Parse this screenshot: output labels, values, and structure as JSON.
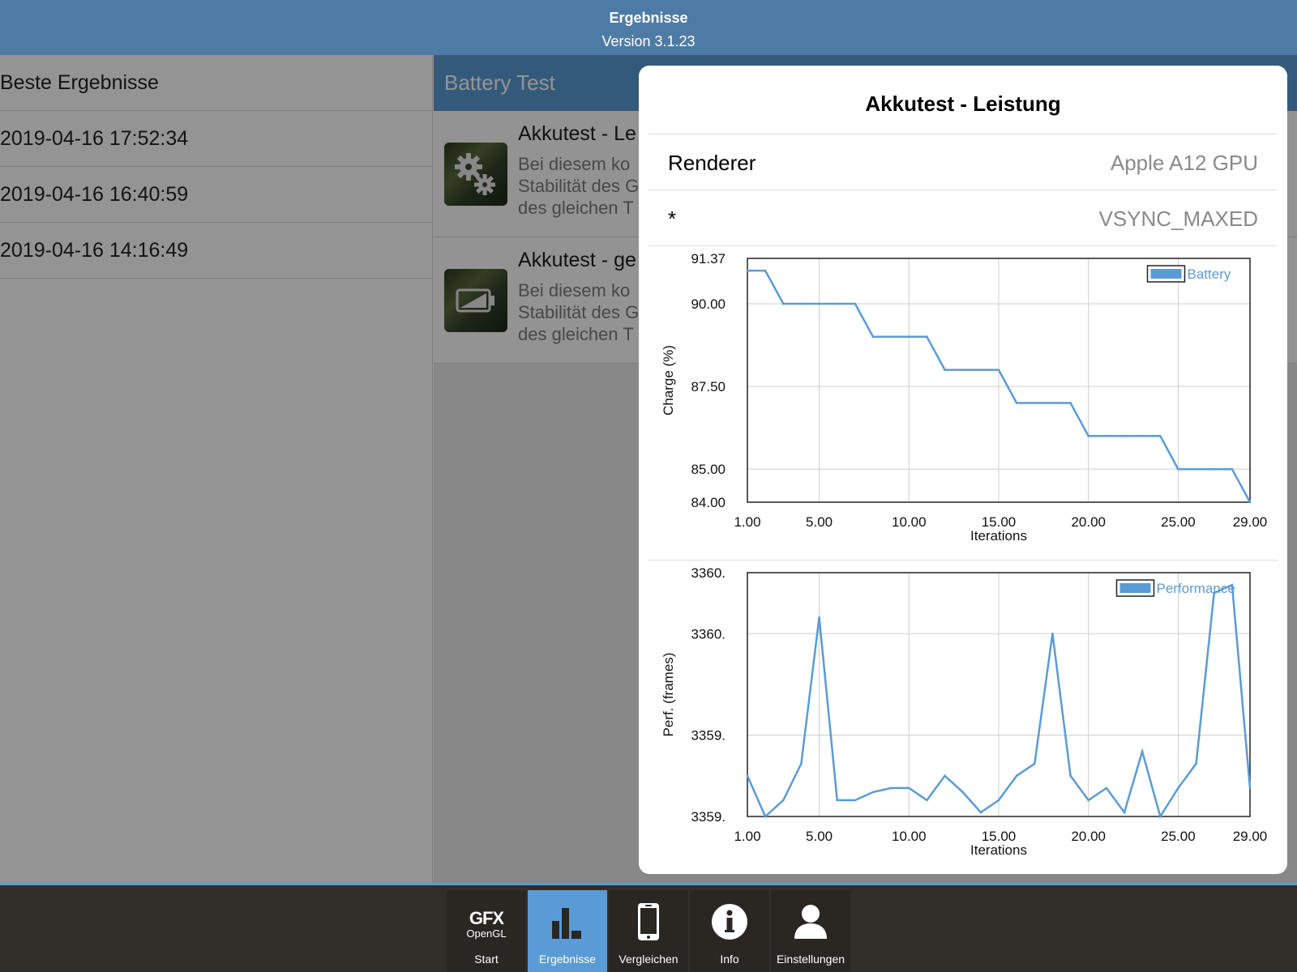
{
  "header": {
    "title": "Ergebnisse",
    "subtitle": "Version 3.1.23"
  },
  "left_list": {
    "title": "Beste Ergebnisse",
    "items": [
      "2019-04-16 17:52:34",
      "2019-04-16 16:40:59",
      "2019-04-16 14:16:49"
    ]
  },
  "middle": {
    "header": "Battery Test",
    "items": [
      {
        "title": "Akkutest - Le",
        "desc": [
          "Bei diesem ko",
          "Stabilität des G",
          "des gleichen T"
        ],
        "icon": "gears-icon"
      },
      {
        "title": "Akkutest - ge",
        "desc": [
          "Bei diesem ko",
          "Stabilität des G",
          "des gleichen T"
        ],
        "icon": "battery-icon"
      }
    ]
  },
  "popover": {
    "title": "Akkutest - Leistung",
    "rows": [
      {
        "key": "Renderer",
        "value": "Apple A12 GPU"
      },
      {
        "key": "*",
        "value": "VSYNC_MAXED"
      }
    ]
  },
  "colors": {
    "accent": "#5b9bd5",
    "header": "#4e7ba6",
    "line": "#5b9bd5",
    "tabbar": "#322e2a"
  },
  "chart_data": [
    {
      "type": "line",
      "ylabel": "Charge (%)",
      "xlabel": "Iterations",
      "xlim": [
        1,
        29
      ],
      "ylim": [
        84.0,
        91.37
      ],
      "xticks": [
        "1.00",
        "5.00",
        "10.00",
        "15.00",
        "20.00",
        "25.00",
        "29.00"
      ],
      "xtick_values": [
        1,
        5,
        10,
        15,
        20,
        25,
        29
      ],
      "yticks": [
        "91.37",
        "90.00",
        "87.50",
        "85.00",
        "84.00"
      ],
      "ytick_values": [
        91.37,
        90.0,
        87.5,
        85.0,
        84.0
      ],
      "grid": true,
      "legend_position": "top-right",
      "series": [
        {
          "name": "Battery",
          "x": [
            1,
            2,
            3,
            4,
            5,
            6,
            7,
            8,
            9,
            10,
            11,
            12,
            13,
            14,
            15,
            16,
            17,
            18,
            19,
            20,
            21,
            22,
            23,
            24,
            25,
            26,
            27,
            28,
            29
          ],
          "values": [
            91,
            91,
            90,
            90,
            90,
            90,
            90,
            89,
            89,
            89,
            89,
            88,
            88,
            88,
            88,
            87,
            87,
            87,
            87,
            86,
            86,
            86,
            86,
            86,
            85,
            85,
            85,
            85,
            84
          ]
        }
      ]
    },
    {
      "type": "line",
      "ylabel": "Perf. (frames)",
      "xlabel": "Iterations",
      "xlim": [
        1,
        29
      ],
      "ylim": [
        3359.1,
        3360.3
      ],
      "xticks": [
        "1.00",
        "5.00",
        "10.00",
        "15.00",
        "20.00",
        "25.00",
        "29.00"
      ],
      "xtick_values": [
        1,
        5,
        10,
        15,
        20,
        25,
        29
      ],
      "yticks": [
        "3360.",
        "3360.",
        "3359.",
        "3359."
      ],
      "ytick_values": [
        3360.3,
        3360.0,
        3359.5,
        3359.1
      ],
      "grid": true,
      "legend_position": "top-right",
      "series": [
        {
          "name": "Performance",
          "x": [
            1,
            2,
            3,
            4,
            5,
            6,
            7,
            8,
            9,
            10,
            11,
            12,
            13,
            14,
            15,
            16,
            17,
            18,
            19,
            20,
            21,
            22,
            23,
            24,
            25,
            26,
            27,
            28,
            29
          ],
          "values": [
            3359.3,
            3359.1,
            3359.18,
            3359.36,
            3360.08,
            3359.18,
            3359.18,
            3359.22,
            3359.24,
            3359.24,
            3359.18,
            3359.3,
            3359.22,
            3359.12,
            3359.18,
            3359.3,
            3359.36,
            3360.0,
            3359.3,
            3359.18,
            3359.24,
            3359.12,
            3359.42,
            3359.1,
            3359.24,
            3359.36,
            3360.2,
            3360.24,
            3359.24
          ]
        }
      ]
    }
  ],
  "tabbar": {
    "tabs": [
      {
        "label": "Start",
        "icon": "gfx-opengl-logo-icon",
        "logo_text": "GFX",
        "logo_sub": "OpenGL"
      },
      {
        "label": "Ergebnisse",
        "icon": "bar-chart-icon",
        "active": true
      },
      {
        "label": "Vergleichen",
        "icon": "phone-icon"
      },
      {
        "label": "Info",
        "icon": "info-icon"
      },
      {
        "label": "Einstellungen",
        "icon": "person-icon"
      }
    ]
  }
}
